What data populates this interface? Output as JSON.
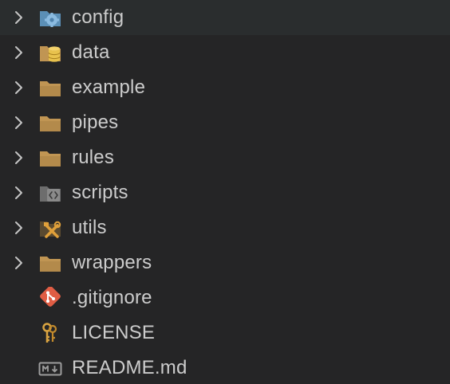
{
  "explorer": {
    "items": [
      {
        "label": "config",
        "kind": "folder",
        "icon": "folder-config-icon",
        "collapsed": true
      },
      {
        "label": "data",
        "kind": "folder",
        "icon": "folder-database-icon",
        "collapsed": true
      },
      {
        "label": "example",
        "kind": "folder",
        "icon": "folder-icon",
        "collapsed": true
      },
      {
        "label": "pipes",
        "kind": "folder",
        "icon": "folder-icon",
        "collapsed": true
      },
      {
        "label": "rules",
        "kind": "folder",
        "icon": "folder-icon",
        "collapsed": true
      },
      {
        "label": "scripts",
        "kind": "folder",
        "icon": "folder-scripts-icon",
        "collapsed": true
      },
      {
        "label": "utils",
        "kind": "folder",
        "icon": "folder-tools-icon",
        "collapsed": true
      },
      {
        "label": "wrappers",
        "kind": "folder",
        "icon": "folder-icon",
        "collapsed": true
      },
      {
        "label": ".gitignore",
        "kind": "file",
        "icon": "git-icon"
      },
      {
        "label": "LICENSE",
        "kind": "file",
        "icon": "license-key-icon"
      },
      {
        "label": "README.md",
        "kind": "file",
        "icon": "markdown-icon"
      }
    ]
  },
  "colors": {
    "background": "#252526",
    "text": "#cccccc",
    "folder": "#c09553",
    "chevron": "#c5c5c5",
    "git": "#e05d44",
    "markdown": "#9d9d9d"
  }
}
